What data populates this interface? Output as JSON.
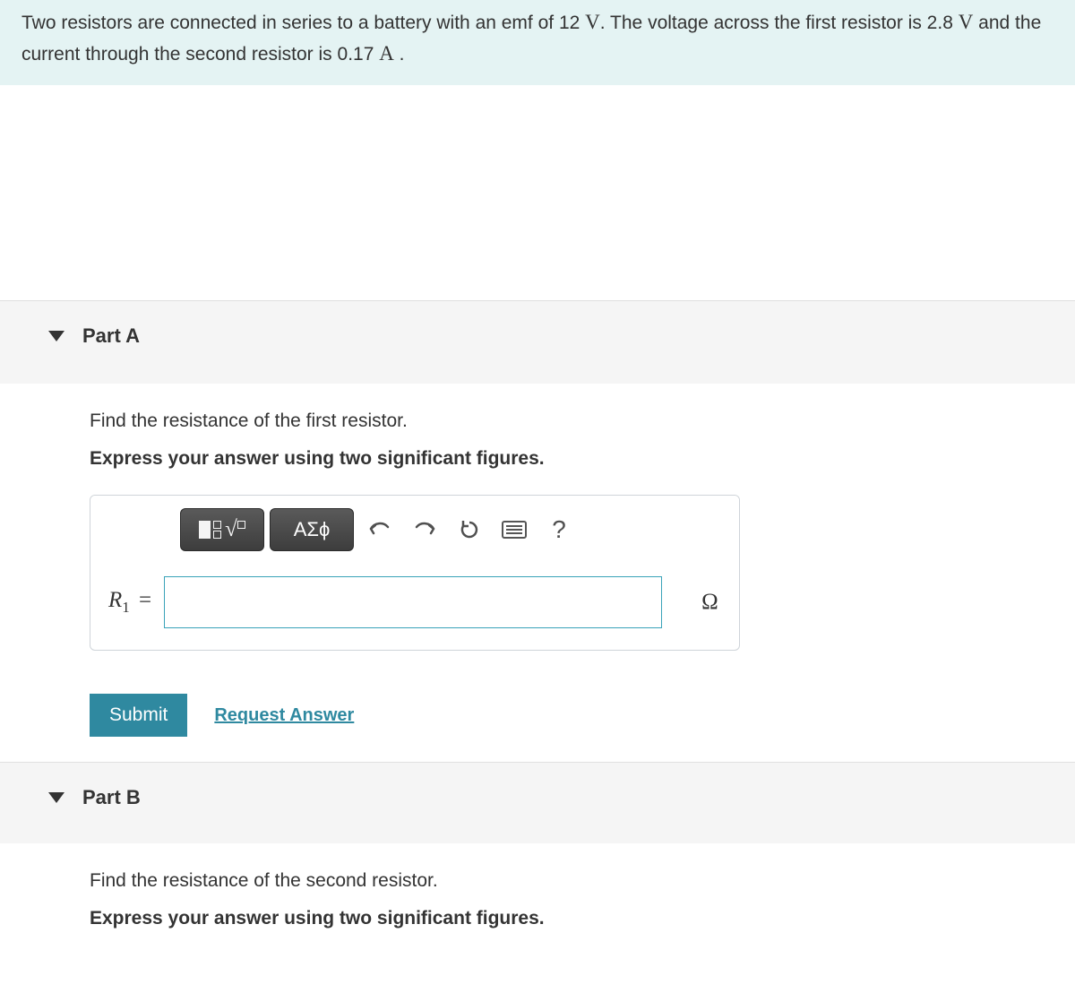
{
  "problem": {
    "segments": [
      "Two resistors are connected in series to a battery with an emf of 12 ",
      "V",
      ". The voltage across the first resistor is 2.8 ",
      "V",
      " and the current through the second resistor is 0.17 ",
      "A",
      " ."
    ]
  },
  "partA": {
    "title": "Part A",
    "instruction": "Find the resistance of the first resistor.",
    "express": "Express your answer using two significant figures.",
    "symbols_label": "ΑΣϕ",
    "help_label": "?",
    "variable_html": "R",
    "variable_sub": "1",
    "equals": " =",
    "input_value": "",
    "unit": "Ω",
    "submit": "Submit",
    "request": "Request Answer"
  },
  "partB": {
    "title": "Part B",
    "instruction": "Find the resistance of the second resistor.",
    "express": "Express your answer using two significant figures."
  }
}
